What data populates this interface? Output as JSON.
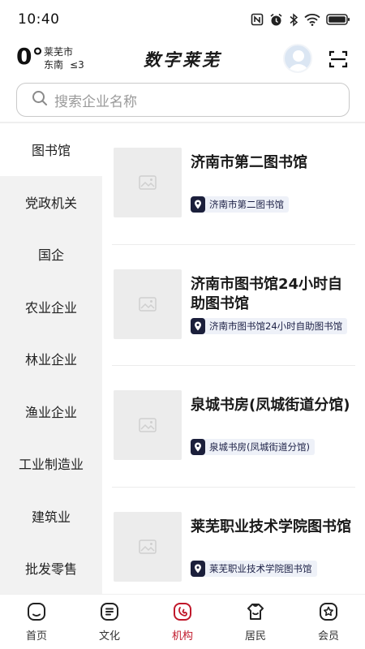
{
  "status_bar": {
    "time": "10:40",
    "icons": [
      "nfc-icon",
      "alarm-icon",
      "bluetooth-icon",
      "wifi-icon",
      "battery-icon"
    ]
  },
  "header": {
    "temperature": "0°",
    "city": "莱芜市",
    "wind_direction": "东南",
    "wind_level": "≤3",
    "app_title": "数字莱芜"
  },
  "search": {
    "placeholder": "搜索企业名称"
  },
  "sidebar": {
    "items": [
      {
        "label": "图书馆",
        "active": true
      },
      {
        "label": "党政机关"
      },
      {
        "label": "国企"
      },
      {
        "label": "农业企业"
      },
      {
        "label": "林业企业"
      },
      {
        "label": "渔业企业"
      },
      {
        "label": "工业制造业"
      },
      {
        "label": "建筑业"
      },
      {
        "label": "批发零售"
      }
    ]
  },
  "list": {
    "items": [
      {
        "title": "济南市第二图书馆",
        "tag": "济南市第二图书馆"
      },
      {
        "title": "济南市图书馆24小时自助图书馆",
        "tag": "济南市图书馆24小时自助图书馆"
      },
      {
        "title": "泉城书房(凤城街道分馆)",
        "tag": "泉城书房(凤城街道分馆)"
      },
      {
        "title": "莱芜职业技术学院图书馆",
        "tag": "莱芜职业技术学院图书馆"
      }
    ]
  },
  "tabbar": {
    "items": [
      {
        "label": "首页",
        "icon": "home-icon"
      },
      {
        "label": "文化",
        "icon": "culture-icon"
      },
      {
        "label": "机构",
        "icon": "organization-icon",
        "active": true
      },
      {
        "label": "居民",
        "icon": "resident-icon"
      },
      {
        "label": "会员",
        "icon": "member-icon"
      }
    ]
  },
  "colors": {
    "accent": "#c0182a",
    "tag_bg": "#eef1f8",
    "tag_icon": "#1b1f3b",
    "sidebar_bg": "#f2f2f2"
  }
}
